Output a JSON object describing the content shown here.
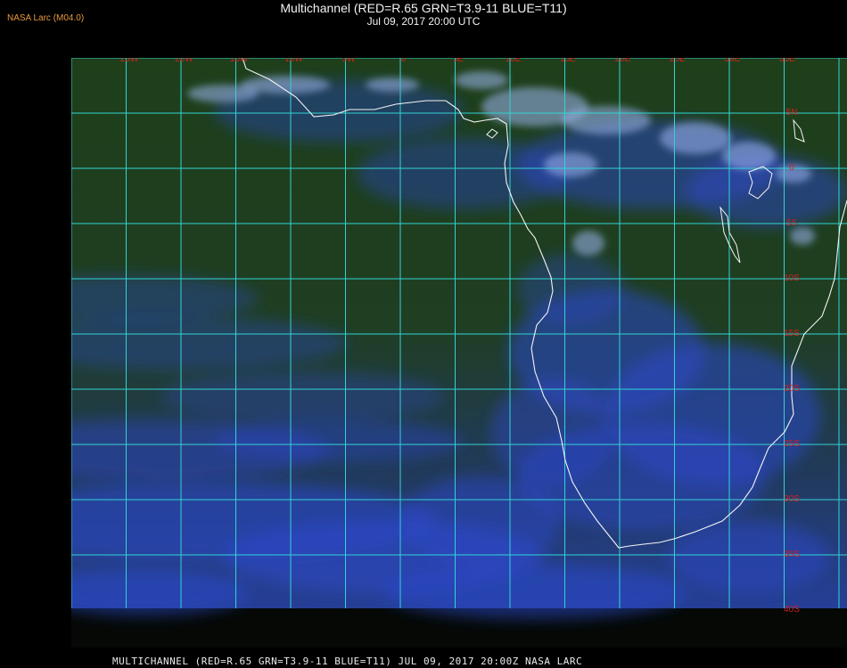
{
  "header": {
    "badge": "NASA Larc (M04.0)",
    "title": "Multichannel (RED=R.65 GRN=T3.9-11 BLUE=T11)",
    "subtitle": "Jul 09, 2017 20:00 UTC"
  },
  "footer": {
    "caption": "MULTICHANNEL (RED=R.65 GRN=T3.9-11 BLUE=T11) JUL 09, 2017 20:00Z  NASA LARC"
  },
  "map": {
    "lon_labels": [
      "25W",
      "20W",
      "15W",
      "10W",
      "5W",
      "0",
      "5E",
      "10E",
      "15E",
      "20E",
      "25E",
      "30E",
      "35E"
    ],
    "lat_labels": [
      "5N",
      "0",
      "5S",
      "10S",
      "15S",
      "20S",
      "25S",
      "30S",
      "35S",
      "40S"
    ],
    "colors": {
      "grid": "#32d4d4",
      "coast": "#f4f4f4",
      "label": "#d22020",
      "ocean_green": "#1e3f1a",
      "land_green": "#24461c",
      "cloud_blue": "#2b47c8",
      "high_cloud": "#9fb6f2"
    }
  }
}
